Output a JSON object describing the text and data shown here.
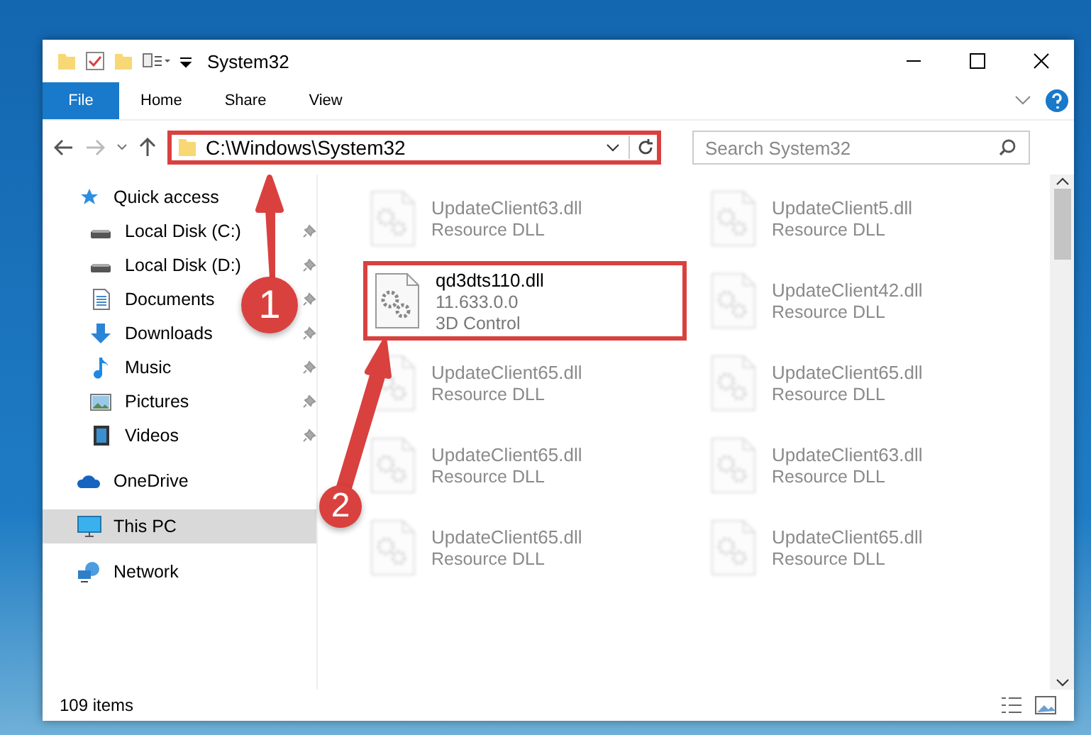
{
  "window": {
    "title": "System32"
  },
  "ribbon": {
    "tabs": [
      {
        "label": "File",
        "selected": true
      },
      {
        "label": "Home",
        "selected": false
      },
      {
        "label": "Share",
        "selected": false
      },
      {
        "label": "View",
        "selected": false
      }
    ]
  },
  "address_bar": {
    "path": "C:\\Windows\\System32",
    "highlighted": true
  },
  "search": {
    "placeholder": "Search System32"
  },
  "sidebar": {
    "items": [
      {
        "label": "Quick access",
        "kind": "star",
        "selected": false,
        "children": [
          {
            "label": "Local Disk (C:)",
            "kind": "disk",
            "pinned": true
          },
          {
            "label": "Local Disk (D:)",
            "kind": "disk",
            "pinned": true
          },
          {
            "label": "Documents",
            "kind": "documents",
            "pinned": true
          },
          {
            "label": "Downloads",
            "kind": "downloads",
            "pinned": true
          },
          {
            "label": "Music",
            "kind": "music",
            "pinned": true
          },
          {
            "label": "Pictures",
            "kind": "pictures",
            "pinned": true
          },
          {
            "label": "Videos",
            "kind": "videos",
            "pinned": true
          }
        ]
      },
      {
        "label": "OneDrive",
        "kind": "cloud",
        "selected": false
      },
      {
        "label": "This PC",
        "kind": "pc",
        "selected": true
      },
      {
        "label": "Network",
        "kind": "network",
        "selected": false
      }
    ]
  },
  "files": [
    {
      "name": "UpdateClient63.dll",
      "details": [
        "Resource DLL"
      ],
      "blurred": true,
      "highlighted": false
    },
    {
      "name": "UpdateClient5.dll",
      "details": [
        "Resource DLL"
      ],
      "blurred": true,
      "highlighted": false
    },
    {
      "name": "qd3dts110.dll",
      "details": [
        "11.633.0.0",
        "3D Control"
      ],
      "blurred": false,
      "highlighted": true
    },
    {
      "name": "UpdateClient42.dll",
      "details": [
        "Resource DLL"
      ],
      "blurred": true,
      "highlighted": false
    },
    {
      "name": "UpdateClient65.dll",
      "details": [
        "Resource DLL"
      ],
      "blurred": true,
      "highlighted": false
    },
    {
      "name": "UpdateClient65.dll",
      "details": [
        "Resource DLL"
      ],
      "blurred": true,
      "highlighted": false
    },
    {
      "name": "UpdateClient65.dll",
      "details": [
        "Resource DLL"
      ],
      "blurred": true,
      "highlighted": false
    },
    {
      "name": "UpdateClient63.dll",
      "details": [
        "Resource DLL"
      ],
      "blurred": true,
      "highlighted": false
    },
    {
      "name": "UpdateClient65.dll",
      "details": [
        "Resource DLL"
      ],
      "blurred": true,
      "highlighted": false
    },
    {
      "name": "UpdateClient65.dll",
      "details": [
        "Resource DLL"
      ],
      "blurred": true,
      "highlighted": false
    }
  ],
  "status_bar": {
    "item_count": "109 items"
  },
  "annotations": [
    {
      "label": "1"
    },
    {
      "label": "2"
    }
  ]
}
